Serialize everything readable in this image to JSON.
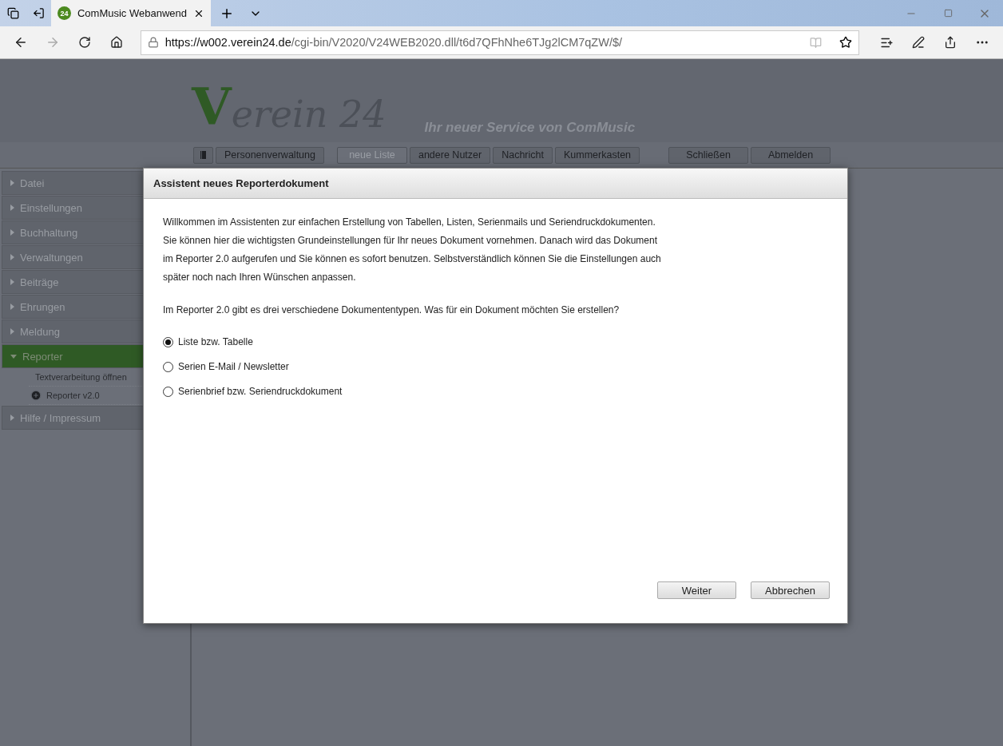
{
  "browser": {
    "tabs": [
      {
        "title": "ComMusic Webanwend",
        "favicon": "24",
        "selected": true
      }
    ],
    "url_host": "https://w002.verein24.de",
    "url_path": "/cgi-bin/V2020/V24WEB2020.dll/t6d7QFhNhe6TJg2lCM7qZW/$/"
  },
  "header": {
    "logo_initial": "V",
    "logo_rest": "erein 24",
    "tagline": "Ihr neuer Service von ComMusic"
  },
  "toolbar": {
    "groups": [
      [
        {
          "kind": "icon",
          "disabled": false
        },
        {
          "kind": "text",
          "label": "Personenverwaltung",
          "disabled": false
        }
      ],
      [
        {
          "kind": "text",
          "label": "neue Liste",
          "disabled": true
        },
        {
          "kind": "text",
          "label": "andere Nutzer",
          "disabled": false
        },
        {
          "kind": "text",
          "label": "Nachricht",
          "disabled": false
        },
        {
          "kind": "text",
          "label": "Kummerkasten",
          "disabled": false
        }
      ],
      [
        {
          "kind": "text",
          "label": "Schließen",
          "disabled": false
        },
        {
          "kind": "text",
          "label": "Abmelden",
          "disabled": false
        }
      ]
    ]
  },
  "sidebar": {
    "items": [
      {
        "label": "Datei",
        "expanded": false
      },
      {
        "label": "Einstellungen",
        "expanded": false
      },
      {
        "label": "Buchhaltung",
        "expanded": false
      },
      {
        "label": "Verwaltungen",
        "expanded": false
      },
      {
        "label": "Beiträge",
        "expanded": false
      },
      {
        "label": "Ehrungen",
        "expanded": false
      },
      {
        "label": "Meldung",
        "expanded": false
      },
      {
        "label": "Reporter",
        "expanded": true,
        "children": [
          {
            "label": "Textverarbeitung öffnen",
            "kind": "plain"
          },
          {
            "label": "Reporter v2.0",
            "kind": "add"
          }
        ]
      },
      {
        "label": "Hilfe / Impressum",
        "expanded": false
      }
    ]
  },
  "dialog": {
    "title": "Assistent neues Reporterdokument",
    "intro": [
      "Willkommen im Assistenten zur einfachen Erstellung von Tabellen, Listen, Serienmails und Seriendruckdokumenten.",
      "Sie können hier die wichtigsten Grundeinstellungen für Ihr neues Dokument vornehmen. Danach wird das Dokument",
      "im Reporter 2.0 aufgerufen und Sie können es sofort benutzen. Selbstverständlich können Sie die Einstellungen auch",
      "später noch nach Ihren Wünschen anpassen."
    ],
    "question": "Im Reporter 2.0 gibt es drei verschiedene Dokumententypen. Was für ein Dokument möchten Sie erstellen?",
    "options": [
      {
        "label": "Liste bzw. Tabelle",
        "selected": true
      },
      {
        "label": "Serien E-Mail / Newsletter",
        "selected": false
      },
      {
        "label": "Serienbrief bzw. Seriendruckdokument",
        "selected": false
      }
    ],
    "buttons": [
      "Weiter",
      "Abbrechen"
    ]
  }
}
